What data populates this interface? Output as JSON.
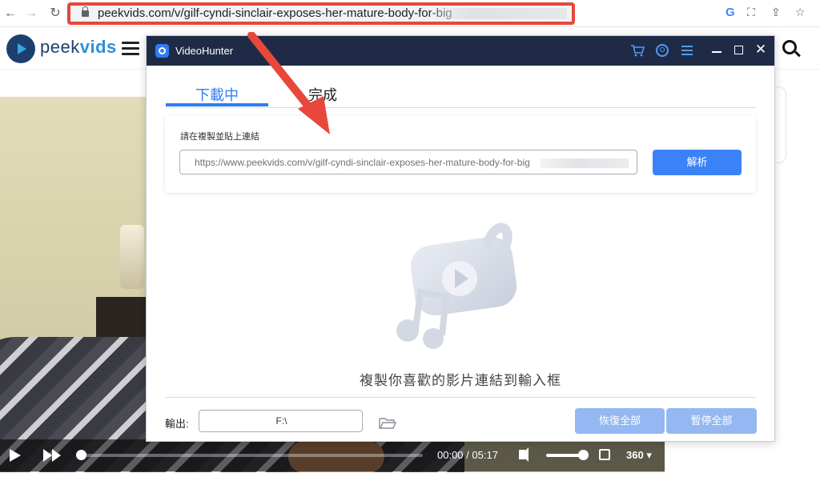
{
  "browser": {
    "url": "peekvids.com/v/gilf-cyndi-sinclair-exposes-her-mature-body-for-big",
    "back_icon": "arrow-left-icon",
    "forward_icon": "arrow-right-icon",
    "reload_icon": "reload-icon",
    "google_label": "G",
    "accent_color": "#e8473b"
  },
  "site": {
    "logo_prefix": "peek",
    "logo_suffix": "vids"
  },
  "player": {
    "current_time": "00:00",
    "separator": "/",
    "duration": "05:17",
    "quality": "360",
    "progress": 0.0,
    "volume": 0.9
  },
  "videohunter": {
    "title": "VideoHunter",
    "tabs": [
      {
        "label": "下載中",
        "active": true
      },
      {
        "label": "完成",
        "active": false
      }
    ],
    "url_card": {
      "label": "請在複製並貼上連結",
      "url_value": "https://www.peekvids.com/v/gilf-cyndi-sinclair-exposes-her-mature-body-for-big",
      "parse_button": "解析"
    },
    "empty_message": "複製你喜歡的影片連結到輸入框",
    "output": {
      "label": "輸出:",
      "path": "F:\\"
    },
    "resume_all": "恢復全部",
    "pause_all": "暫停全部",
    "accent_color": "#3b82f6",
    "titlebar_color": "#1f2b46"
  }
}
